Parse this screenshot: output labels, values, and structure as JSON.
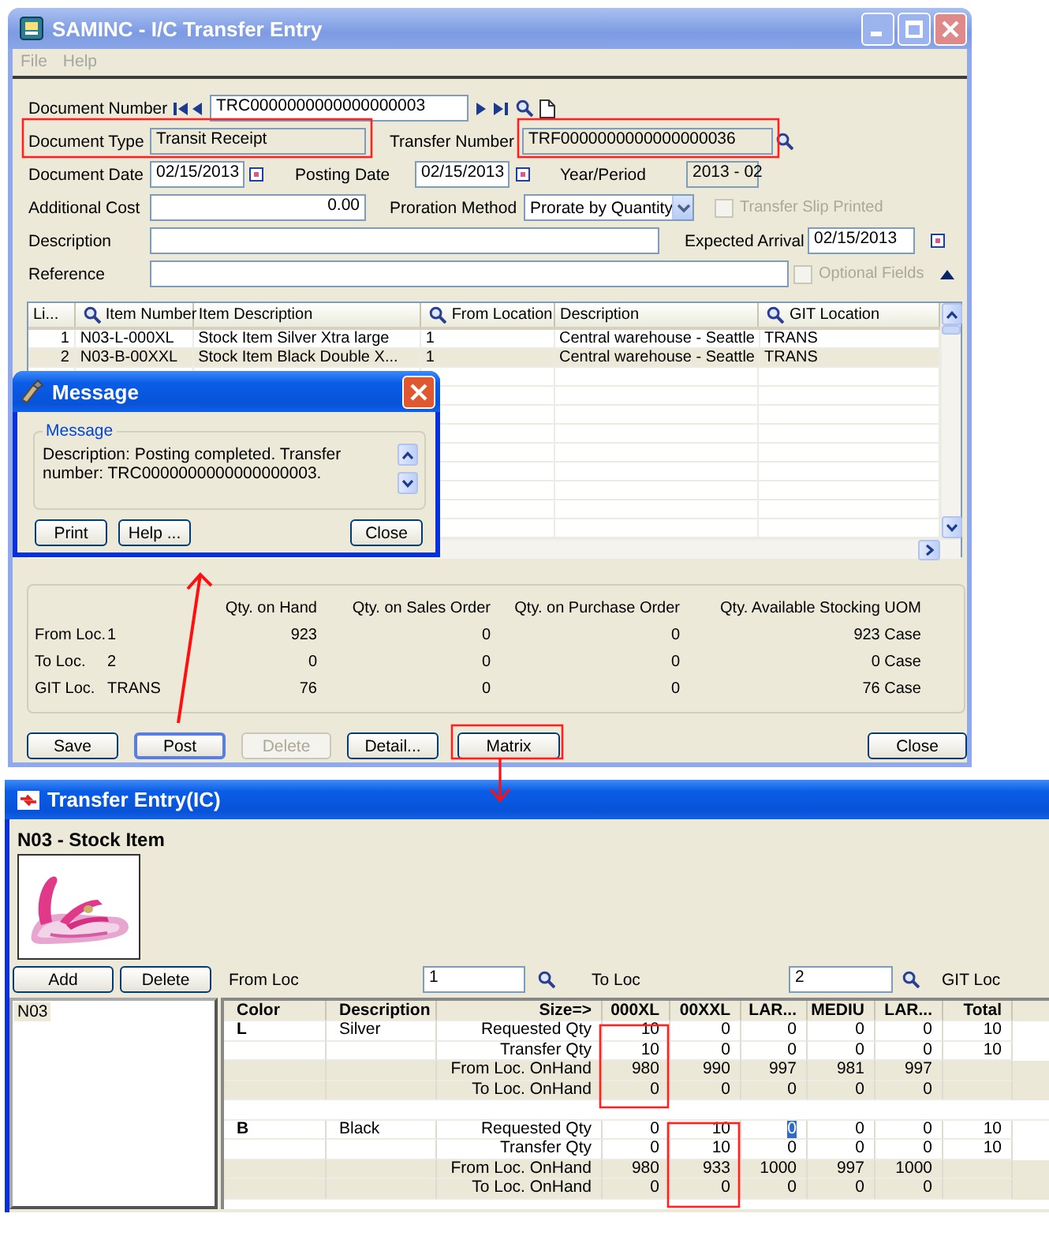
{
  "main_window": {
    "title": "SAMINC - I/C Transfer Entry",
    "menu": [
      "File",
      "Help"
    ],
    "document_number": {
      "label": "Document Number",
      "value": "TRC0000000000000000003"
    },
    "document_type": {
      "label": "Document Type",
      "value": "Transit Receipt"
    },
    "transfer_number": {
      "label": "Transfer Number",
      "value": "TRF0000000000000000036"
    },
    "document_date": {
      "label": "Document Date",
      "value": "02/15/2013"
    },
    "posting_date": {
      "label": "Posting Date",
      "value": "02/15/2013"
    },
    "year_period": {
      "label": "Year/Period",
      "value": "2013 - 02"
    },
    "additional_cost": {
      "label": "Additional Cost",
      "value": "0.00"
    },
    "proration_method": {
      "label": "Proration Method",
      "value": "Prorate by Quantity"
    },
    "transfer_slip_printed": {
      "label": "Transfer Slip Printed",
      "checked": false,
      "disabled": true
    },
    "description": {
      "label": "Description"
    },
    "expected_arrival": {
      "label": "Expected Arrival",
      "value": "02/15/2013"
    },
    "reference": {
      "label": "Reference"
    },
    "optional_fields": {
      "label": "Optional Fields",
      "checked": false,
      "disabled": true
    },
    "grid": {
      "columns": [
        {
          "label": "Li...",
          "search": false
        },
        {
          "label": "Item Number",
          "search": true
        },
        {
          "label": "Item Description",
          "search": false
        },
        {
          "label": "From Location",
          "search": true
        },
        {
          "label": "Description",
          "search": false
        },
        {
          "label": "GIT Location",
          "search": true
        }
      ],
      "rows": [
        {
          "cells": [
            "1",
            "N03-L-000XL",
            "Stock Item Silver Xtra large",
            "1",
            "Central warehouse - Seattle",
            "TRANS"
          ],
          "selected": false
        },
        {
          "cells": [
            "2",
            "N03-B-00XXL",
            "Stock Item Black Double X...",
            "1",
            "Central warehouse - Seattle",
            "TRANS"
          ],
          "selected": true
        }
      ]
    },
    "stats": {
      "columns": [
        "Qty. on Hand",
        "Qty. on Sales Order",
        "Qty. on Purchase Order",
        "Qty. Available Stocking UOM"
      ],
      "rows": [
        {
          "label": "From Loc.",
          "location": "1",
          "values": [
            "923",
            "0",
            "0",
            "923 Case"
          ]
        },
        {
          "label": "To Loc.",
          "location": "2",
          "values": [
            "0",
            "0",
            "0",
            "0 Case"
          ]
        },
        {
          "label": "GIT Loc.",
          "location": "TRANS",
          "values": [
            "76",
            "0",
            "0",
            "76 Case"
          ]
        }
      ]
    },
    "buttons": [
      {
        "label": "Save",
        "disabled": false
      },
      {
        "label": "Post",
        "disabled": false
      },
      {
        "label": "Delete",
        "disabled": true
      },
      {
        "label": "Detail...",
        "disabled": false
      },
      {
        "label": "Matrix",
        "disabled": false
      },
      {
        "label": "Close",
        "disabled": false
      }
    ]
  },
  "message_dialog": {
    "title": "Message",
    "group": "Message",
    "text": "Description: Posting completed. Transfer number: TRC0000000000000000003.",
    "buttons": [
      "Print",
      "Help ...",
      "Close"
    ]
  },
  "matrix_window": {
    "title": "Transfer Entry(IC)",
    "item_heading": "N03 - Stock Item",
    "buttons": [
      "Add",
      "Delete"
    ],
    "from_loc": {
      "label": "From Loc",
      "value": "1"
    },
    "to_loc": {
      "label": "To Loc",
      "value": "2"
    },
    "git_loc": {
      "label": "GIT Loc"
    },
    "items": [
      {
        "label": "N03",
        "selected": true
      }
    ],
    "columns": [
      "Color",
      "Description",
      "Size=>",
      "000XL",
      "00XXL",
      "LAR...",
      "MEDIU",
      "LAR...",
      "Total"
    ],
    "groups": [
      {
        "color_code": "L",
        "description": "Silver",
        "lines": [
          {
            "label": "Requested Qty",
            "values": [
              "10",
              "0",
              "0",
              "0",
              "0",
              "10"
            ],
            "shaded": false
          },
          {
            "label": "Transfer Qty",
            "values": [
              "10",
              "0",
              "0",
              "0",
              "0",
              "10"
            ],
            "shaded": false
          },
          {
            "label": "From Loc. OnHand",
            "values": [
              "980",
              "990",
              "997",
              "981",
              "997"
            ],
            "shaded": true
          },
          {
            "label": "To Loc. OnHand",
            "values": [
              "0",
              "0",
              "0",
              "0",
              "0"
            ],
            "shaded": true
          }
        ]
      },
      {
        "color_code": "B",
        "description": "Black",
        "lines": [
          {
            "label": "Requested Qty",
            "values": [
              "0",
              "10",
              "0",
              "0",
              "0",
              "10"
            ],
            "shaded": false,
            "focused": [
              false,
              false,
              true,
              false,
              false,
              false
            ]
          },
          {
            "label": "Transfer Qty",
            "values": [
              "0",
              "10",
              "0",
              "0",
              "0",
              "10"
            ],
            "shaded": false
          },
          {
            "label": "From Loc. OnHand",
            "values": [
              "980",
              "933",
              "1000",
              "997",
              "1000"
            ],
            "shaded": true
          },
          {
            "label": "To Loc. OnHand",
            "values": [
              "0",
              "0",
              "0",
              "0",
              "0"
            ],
            "shaded": true
          }
        ]
      }
    ]
  }
}
